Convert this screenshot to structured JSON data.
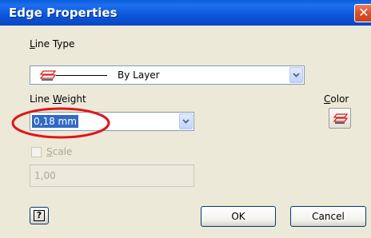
{
  "window": {
    "title": "Edge Properties",
    "close_glyph": "✕"
  },
  "line_type": {
    "label": "Line Type",
    "mnemonic": "L",
    "label_rest": "ine Type",
    "value": "By Layer",
    "icon": "layer-icon"
  },
  "line_weight": {
    "label": "Line Weight",
    "label_pre": "Line ",
    "mnemonic": "W",
    "label_rest": "eight",
    "value": "0,18 mm"
  },
  "color": {
    "label": "Color",
    "mnemonic": "C",
    "label_rest": "olor",
    "icon": "layer-icon"
  },
  "scale": {
    "label": "Scale",
    "mnemonic": "S",
    "label_rest": "cale",
    "checked": false,
    "enabled": false,
    "value": "1,00"
  },
  "buttons": {
    "help_glyph": "?",
    "ok": "OK",
    "cancel": "Cancel"
  },
  "colors": {
    "titlebar": "#0b56d8",
    "dialog_bg": "#ece9d8",
    "highlight_ellipse": "#e0151a",
    "selection": "#316ac5",
    "layer_icon": "#d42020"
  }
}
